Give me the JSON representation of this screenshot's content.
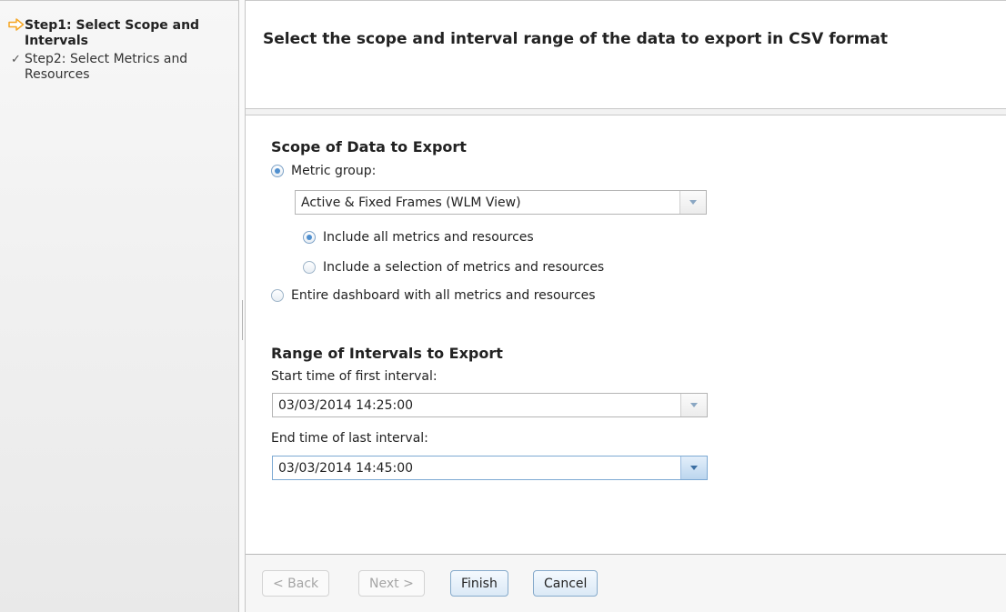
{
  "wizard": {
    "steps": [
      {
        "label": "Step1: Select Scope and Intervals",
        "icon": "arrow-right-icon",
        "current": true
      },
      {
        "label": "Step2: Select Metrics and Resources",
        "icon": "checkmark-icon",
        "current": false
      }
    ]
  },
  "header": {
    "title": "Select the scope and interval range of the data to export in CSV format"
  },
  "scope": {
    "title": "Scope of Data to Export",
    "metric_group_label": "Metric group:",
    "metric_group_value": "Active & Fixed Frames (WLM View)",
    "include_all_label": "Include all metrics and resources",
    "include_selection_label": "Include a selection of metrics and resources",
    "entire_dashboard_label": "Entire dashboard with all metrics and resources",
    "selected_scope": "metric_group",
    "selected_include": "all"
  },
  "range": {
    "title": "Range of Intervals to Export",
    "start_label": "Start time of first interval:",
    "start_value": "03/03/2014 14:25:00",
    "end_label": "End time of last interval:",
    "end_value": "03/03/2014 14:45:00"
  },
  "buttons": {
    "back": "< Back",
    "next": "Next >",
    "finish": "Finish",
    "cancel": "Cancel"
  },
  "colors": {
    "accent_arrow": "#f5a623",
    "radio_checked": "#4f8fcf"
  }
}
